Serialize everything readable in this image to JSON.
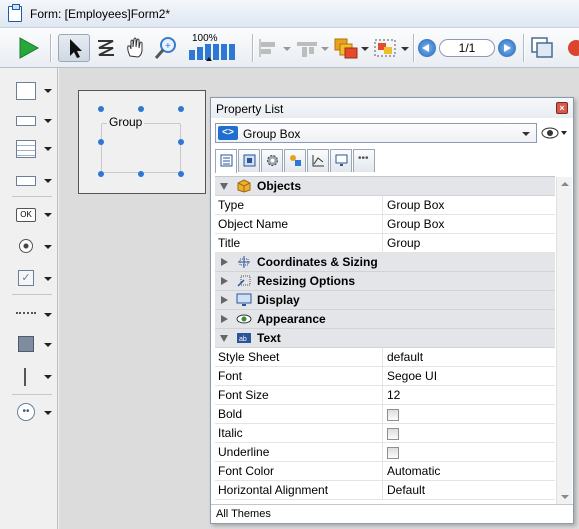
{
  "window": {
    "title": "Form: [Employees]Form2*"
  },
  "toolbar": {
    "zoom_label": "100%",
    "page_indicator": "1/1"
  },
  "canvas": {
    "group_label": "Group"
  },
  "property_list": {
    "title": "Property List",
    "object_selector": "Group Box",
    "sections": [
      {
        "name": "Objects",
        "expanded": true,
        "icon": "cube-icon",
        "rows": [
          {
            "key": "Type",
            "value": "Group Box"
          },
          {
            "key": "Object Name",
            "value": "Group Box"
          },
          {
            "key": "Title",
            "value": "Group"
          }
        ]
      },
      {
        "name": "Coordinates & Sizing",
        "expanded": false,
        "icon": "coordinates-icon",
        "rows": []
      },
      {
        "name": "Resizing Options",
        "expanded": false,
        "icon": "resize-icon",
        "rows": []
      },
      {
        "name": "Display",
        "expanded": false,
        "icon": "display-icon",
        "rows": []
      },
      {
        "name": "Appearance",
        "expanded": false,
        "icon": "eye-icon",
        "rows": []
      },
      {
        "name": "Text",
        "expanded": true,
        "icon": "text-icon",
        "rows": [
          {
            "key": "Style Sheet",
            "value": "default"
          },
          {
            "key": "Font",
            "value": "Segoe UI"
          },
          {
            "key": "Font Size",
            "value": "12"
          },
          {
            "key": "Bold",
            "checkbox": true,
            "checked": false
          },
          {
            "key": "Italic",
            "checkbox": true,
            "checked": false
          },
          {
            "key": "Underline",
            "checkbox": true,
            "checked": false
          },
          {
            "key": "Font Color",
            "value": "Automatic"
          },
          {
            "key": "Horizontal Alignment",
            "value": "Default"
          }
        ]
      }
    ],
    "footer": "All Themes"
  },
  "colors": {
    "accent": "#2e78d4",
    "run_green": "#28a83a",
    "category_bg": "#e3e5e8"
  }
}
